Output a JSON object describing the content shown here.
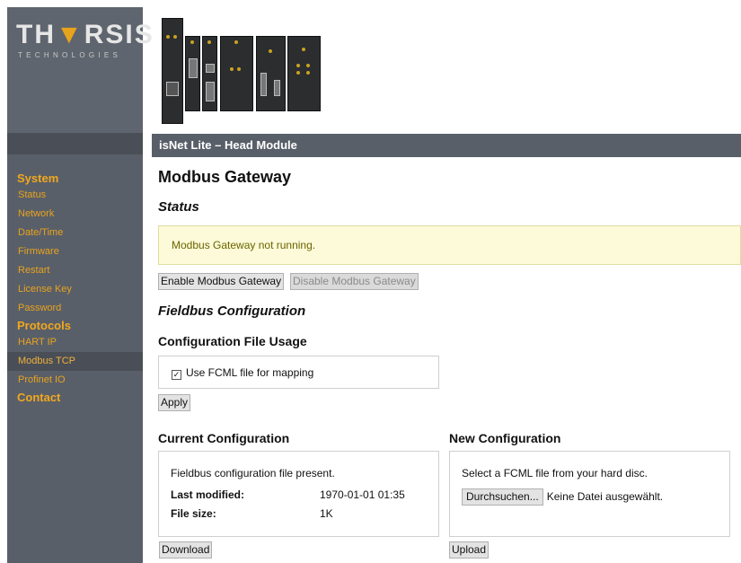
{
  "brand": {
    "name_left": "TH",
    "name_right": "RSIS",
    "tagline": "TECHNOLOGIES"
  },
  "module_title": "isNet Lite – Head Module",
  "nav": {
    "system": "System",
    "system_items": [
      "Status",
      "Network",
      "Date/Time",
      "Firmware",
      "Restart",
      "License Key",
      "Password"
    ],
    "protocols": "Protocols",
    "protocol_items": [
      "HART IP",
      "Modbus TCP",
      "Profinet IO"
    ],
    "active_item": "Modbus TCP",
    "contact": "Contact"
  },
  "page": {
    "title": "Modbus Gateway",
    "status_heading": "Status",
    "status_message": "Modbus Gateway not running.",
    "enable_button": "Enable Modbus Gateway",
    "disable_button": "Disable Modbus Gateway",
    "fieldbus_heading": "Fieldbus Configuration",
    "usage_heading": "Configuration File Usage",
    "use_fcml_label": "Use FCML file for mapping",
    "use_fcml_checked": true,
    "apply_button": "Apply",
    "current": {
      "heading": "Current Configuration",
      "present_text": "Fieldbus configuration file present.",
      "last_modified_label": "Last modified:",
      "last_modified_value": "1970-01-01 01:35",
      "file_size_label": "File size:",
      "file_size_value": "1K",
      "download_button": "Download"
    },
    "new": {
      "heading": "New Configuration",
      "instruction": "Select a FCML file from your hard disc.",
      "browse_button": "Durchsuchen...",
      "no_file_text": "Keine Datei ausgewählt.",
      "upload_button": "Upload"
    }
  },
  "colors": {
    "accent": "#e8a31d",
    "sidebar": "#595f69",
    "status_bg": "#fcfad8",
    "status_text": "#6b6400"
  }
}
